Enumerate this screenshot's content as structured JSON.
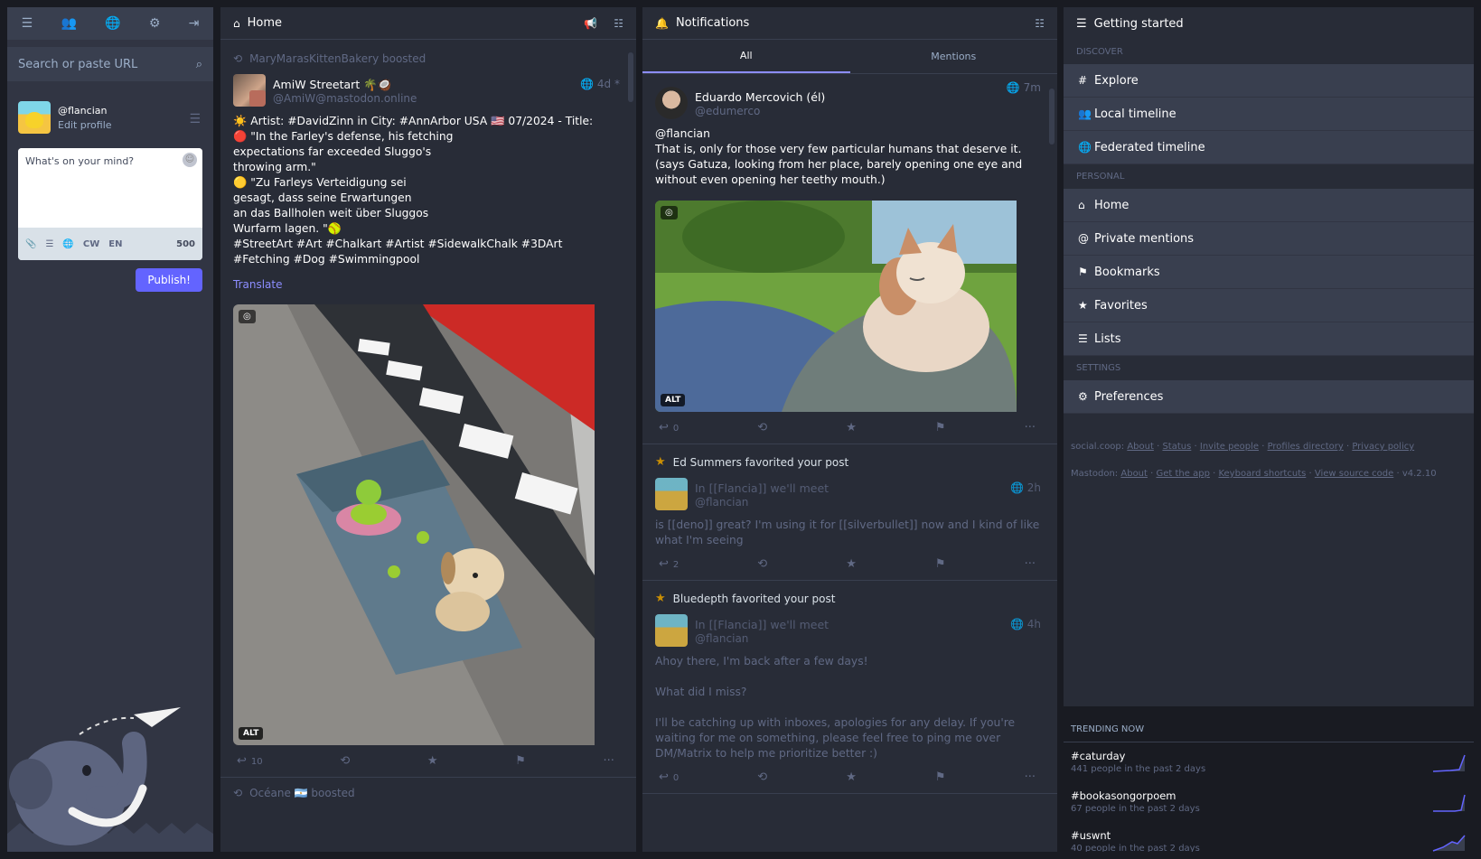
{
  "compose_col": {
    "search_placeholder": "Search or paste URL",
    "user": {
      "handle": "@flancian",
      "edit_label": "Edit profile"
    },
    "compose_placeholder": "What's on your mind?",
    "tools": {
      "cw": "CW",
      "lang": "EN",
      "count": "500"
    },
    "publish_label": "Publish!"
  },
  "home_col": {
    "title": "Home",
    "post1": {
      "boost_by": "MaryMarasKittenBakery boosted",
      "display_name": "AmiW Streetart 🌴🥥",
      "acct": "@AmiW@mastodon.online",
      "time": "4d *",
      "content": "☀️ Artist: #DavidZinn in City: #AnnArbor USA 🇺🇸 07/2024 - Title:\n🔴 \"In the Farley's defense, his fetching\n     expectations far exceeded Sluggo's\n     throwing arm.\"\n🟡 \"Zu Farleys Verteidigung sei\n     gesagt, dass seine Erwartungen\n     an das Ballholen weit über Sluggos\n     Wurfarm lagen. \"🥎\n#StreetArt #Art #Chalkart #Artist #SidewalkChalk #3DArt\n#Fetching #Dog #Swimmingpool",
      "translate_label": "Translate",
      "alt_label": "ALT",
      "reply_count": "10"
    },
    "post2_boost_by": "Océane 🇦🇷 boosted"
  },
  "notif_col": {
    "title": "Notifications",
    "tabs": [
      "All",
      "Mentions"
    ],
    "n1": {
      "display_name": "Eduardo Mercovich (él)",
      "acct": "@edumerco",
      "time": "7m",
      "content": "@flancian\nThat is, only for those very few particular humans that deserve it.\n(says Gatuza, looking from her place, barely opening one eye and\nwithout even opening her teethy mouth.)",
      "alt_label": "ALT",
      "reply_count": "0"
    },
    "n2": {
      "label": "Ed Summers favorited your post",
      "display_name": "In [[Flancia]] we'll meet",
      "acct": "@flancian",
      "time": "2h",
      "content": "is [[deno]] great? I'm using it for [[silverbullet]] now and I kind of like\nwhat I'm seeing",
      "reply_count": "2"
    },
    "n3": {
      "label": "Bluedepth favorited your post",
      "display_name": "In [[Flancia]] we'll meet",
      "acct": "@flancian",
      "time": "4h",
      "content": "Ahoy there, I'm back after a few days!\n\nWhat did I miss?\n\nI'll be catching up with inboxes, apologies for any delay. If you're\nwaiting for me on something, please feel free to ping me over\nDM/Matrix to help me prioritize better :)",
      "reply_count": "0"
    }
  },
  "start_col": {
    "title": "Getting started",
    "discover_label": "DISCOVER",
    "discover": [
      "Explore",
      "Local timeline",
      "Federated timeline"
    ],
    "personal_label": "PERSONAL",
    "personal": [
      "Home",
      "Private mentions",
      "Bookmarks",
      "Favorites",
      "Lists"
    ],
    "settings_label": "SETTINGS",
    "settings": [
      "Preferences"
    ],
    "footer1": {
      "prefix": "social.coop:",
      "links": [
        "About",
        "Status",
        "Invite people",
        "Profiles directory",
        "Privacy policy"
      ]
    },
    "footer2": {
      "prefix": "Mastodon:",
      "links": [
        "About",
        "Get the app",
        "Keyboard shortcuts",
        "View source code"
      ],
      "version": "v4.2.10"
    },
    "trending_label": "TRENDING NOW",
    "trends": [
      {
        "tag": "#caturday",
        "people": "441 people in the past 2 days"
      },
      {
        "tag": "#bookasongorpoem",
        "people": "67 people in the past 2 days"
      },
      {
        "tag": "#uswnt",
        "people": "40 people in the past 2 days"
      }
    ]
  },
  "colors": {
    "accent": "#6364ff",
    "link": "#8c8dff",
    "star": "#ca8f04"
  }
}
